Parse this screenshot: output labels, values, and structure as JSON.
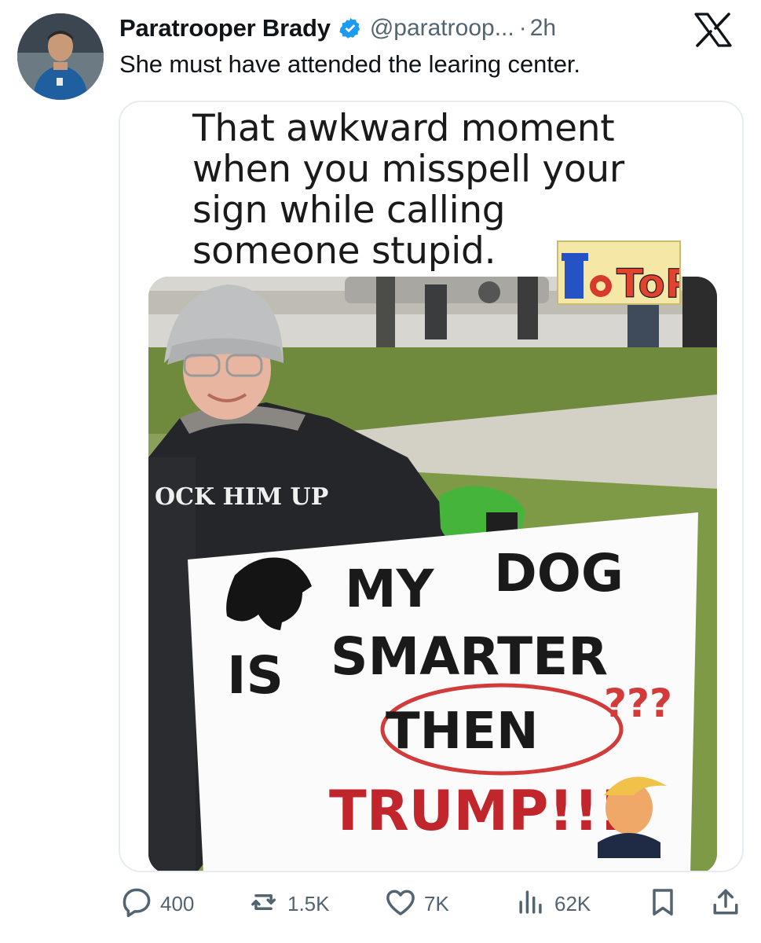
{
  "post": {
    "display_name": "Paratrooper Brady",
    "handle": "@paratroop...",
    "separator": "·",
    "time": "2h",
    "text": "She must have attended the learing center."
  },
  "media": {
    "caption_lines": [
      "That awkward moment",
      "when you misspell your",
      "sign while calling",
      "someone stupid."
    ],
    "watermark": "ToPO",
    "sweatshirt_text": "OCK HIM UP",
    "sign_lines": [
      "MY",
      "DOG",
      "IS",
      "SMARTER",
      "THEN",
      "???",
      "TRUMP!!!"
    ]
  },
  "actions": {
    "replies": "400",
    "reposts": "1.5K",
    "likes": "7K",
    "views": "62K"
  },
  "icons": {
    "verified": "verified-badge-icon",
    "brand": "x-logo-icon",
    "reply": "reply-icon",
    "repost": "repost-icon",
    "like": "heart-icon",
    "views": "views-icon",
    "bookmark": "bookmark-icon",
    "share": "share-icon"
  },
  "colors": {
    "verified": "#1d9bf0",
    "secondary_text": "#536471",
    "primary_text": "#0f1419"
  }
}
